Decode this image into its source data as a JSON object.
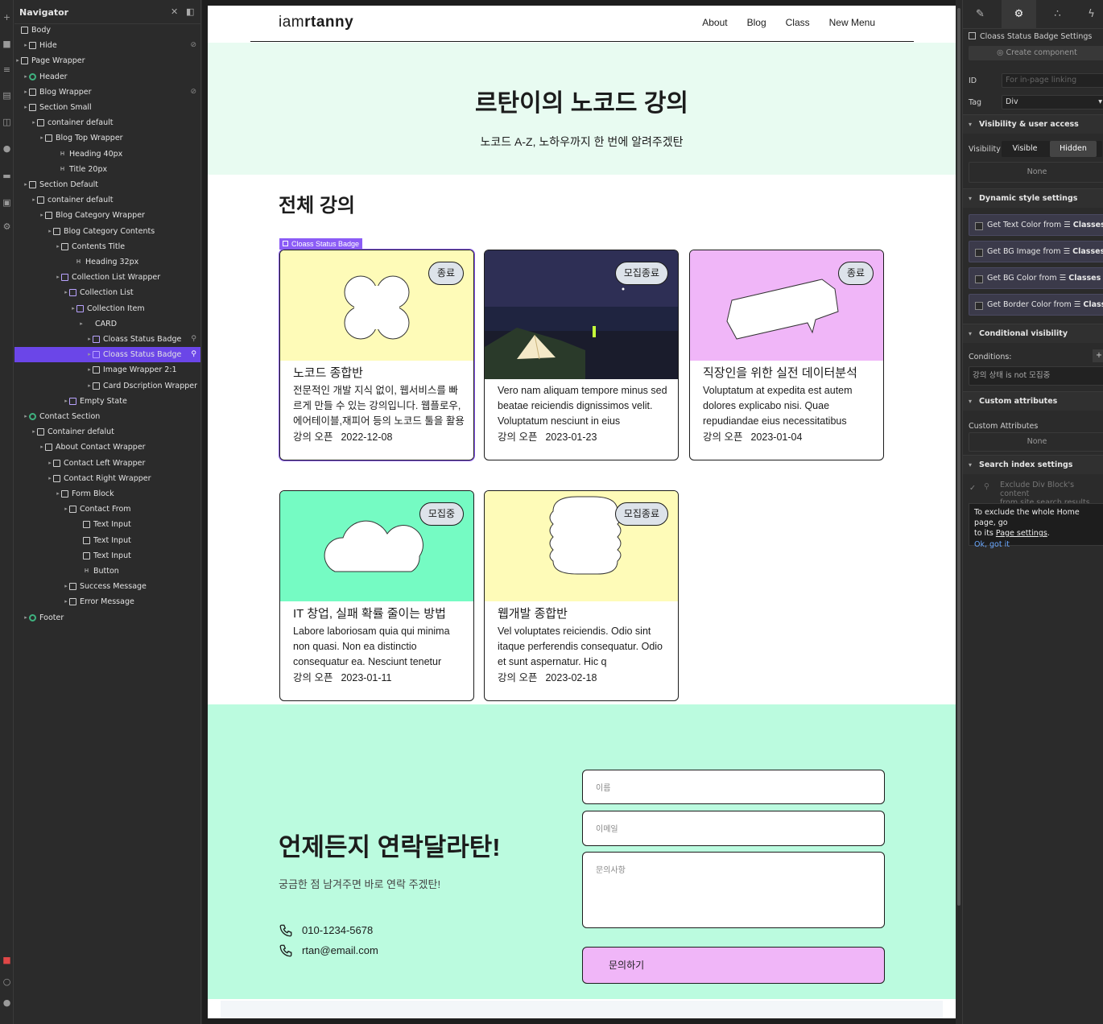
{
  "navigator": {
    "title": "Navigator",
    "items": [
      {
        "label": "Body"
      },
      {
        "label": "Hide"
      },
      {
        "label": "Page Wrapper"
      },
      {
        "label": "Header"
      },
      {
        "label": "Blog Wrapper"
      },
      {
        "label": "Section Small"
      },
      {
        "label": "container default"
      },
      {
        "label": "Blog Top Wrapper"
      },
      {
        "label": "Heading 40px"
      },
      {
        "label": "Title 20px"
      },
      {
        "label": "Section Default"
      },
      {
        "label": "container default"
      },
      {
        "label": "Blog Category Wrapper"
      },
      {
        "label": "Blog Category Contents"
      },
      {
        "label": "Contents Title"
      },
      {
        "label": "Heading 32px"
      },
      {
        "label": "Collection List Wrapper"
      },
      {
        "label": "Collection List"
      },
      {
        "label": "Collection Item"
      },
      {
        "label": "CARD"
      },
      {
        "label": "Cloass Status Badge"
      },
      {
        "label": "Cloass Status Badge"
      },
      {
        "label": "Image Wrapper 2:1"
      },
      {
        "label": "Card Dscription Wrapper"
      },
      {
        "label": "Empty State"
      },
      {
        "label": "Contact Section"
      },
      {
        "label": "Container defalut"
      },
      {
        "label": "About Contact Wrapper"
      },
      {
        "label": "Contact Left Wrapper"
      },
      {
        "label": "Contact Right Wrapper"
      },
      {
        "label": "Form Block"
      },
      {
        "label": "Contact From"
      },
      {
        "label": "Text Input"
      },
      {
        "label": "Text Input"
      },
      {
        "label": "Text Input"
      },
      {
        "label": "Button"
      },
      {
        "label": "Success Message"
      },
      {
        "label": "Error Message"
      },
      {
        "label": "Footer"
      }
    ]
  },
  "site": {
    "logo_light": "iam",
    "logo_bold": "rtanny",
    "menu": [
      "About",
      "Blog",
      "Class",
      "New Menu"
    ],
    "hero_title": "르탄이의 노코드 강의",
    "hero_sub": "노코드 A-Z, 노하우까지 한 번에 알려주겠탄",
    "section_title": "전체 강의",
    "badge_label": "Cloass Status Badge",
    "date_label": "강의 오픈",
    "cards": [
      {
        "status": "종료",
        "title": "노코드 종합반",
        "desc": "전문적인 개발 지식 없이, 웹서비스를 빠르게 만들 수 있는 강의입니다. 웹플로우,에어테이블,재피어 등의 노코드 툴을 활용하",
        "date": "2022-12-08",
        "bg": "#fefbb8",
        "shape": "flower"
      },
      {
        "status": "모집종료",
        "title": "",
        "desc": "Vero nam aliquam tempore minus sed beatae reiciendis dignissimos velit. Voluptatum nesciunt in eius",
        "date": "2023-01-23",
        "bg": "#1f2440",
        "shape": "photo"
      },
      {
        "status": "종료",
        "title": "직장인을 위한 실전 데이터분석",
        "desc": "Voluptatum at expedita est autem dolores explicabo nisi. Quae repudiandae eius necessitatibus",
        "date": "2023-01-04",
        "bg": "#f0b6f8",
        "shape": "speech"
      },
      {
        "status": "모집중",
        "title": "IT 창업, 실패 확률 줄이는 방법",
        "desc": "Labore laboriosam quia qui minima non quasi. Non ea distinctio consequatur ea. Nesciunt tenetur",
        "date": "2023-01-11",
        "bg": "#75fbc3",
        "shape": "cloud"
      },
      {
        "status": "모집종료",
        "title": "웹개발 종합반",
        "desc": "Vel voluptates reiciendis. Odio sint itaque perferendis consequatur. Odio et sunt aspernatur. Hic q",
        "date": "2023-02-18",
        "bg": "#fefbb8",
        "shape": "blob"
      }
    ],
    "contact_title": "언제든지 연락달라탄!",
    "contact_sub": "궁금한 점 남겨주면 바로 연락 주겠탄!",
    "phone": "010-1234-5678",
    "email": "rtan@email.com",
    "ph_name": "이름",
    "ph_email": "이메일",
    "ph_msg": "문의사항",
    "submit": "문의하기"
  },
  "settings": {
    "header": "Cloass Status Badge Settings",
    "create_component": "Create component",
    "id_label": "ID",
    "id_placeholder": "For in-page linking",
    "tag_label": "Tag",
    "tag_value": "Div",
    "vis_title": "Visibility & user access",
    "vis_label": "Visibility",
    "vis_visible": "Visible",
    "vis_hidden": "Hidden",
    "none": "None",
    "dyn_title": "Dynamic style settings",
    "dyn": [
      {
        "prefix": "Get Text Color from",
        "suffix": "Classes"
      },
      {
        "prefix": "Get BG Image from",
        "suffix": "Classes"
      },
      {
        "prefix": "Get BG Color from",
        "suffix": "Classes"
      },
      {
        "prefix": "Get Border Color from",
        "suffix": "Classes"
      }
    ],
    "cond_title": "Conditional visibility",
    "cond_label": "Conditions:",
    "cond_value": "강의 상태 is not 모집중",
    "attr_title": "Custom attributes",
    "attr_label": "Custom Attributes",
    "attr_value": "None",
    "search_title": "Search index settings",
    "exclude_1": "Exclude Div Block's content",
    "exclude_2": "from site search results",
    "tip_1": "To exclude the whole Home page, go",
    "tip_2a": "to its ",
    "tip_2b": "Page settings",
    "tip_2c": ".",
    "tip_ok": "Ok, got it"
  }
}
